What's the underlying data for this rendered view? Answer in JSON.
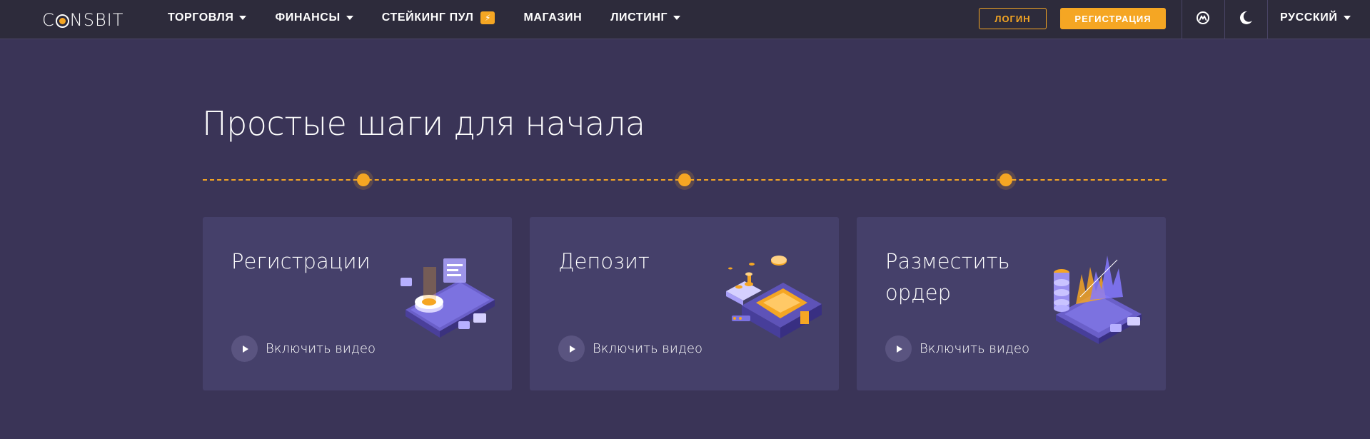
{
  "brand": {
    "logo_pre": "C",
    "logo_post": "NSBIT"
  },
  "nav": {
    "items": [
      {
        "label": "ТОРГОВЛЯ",
        "dropdown": true
      },
      {
        "label": "ФИНАНСЫ",
        "dropdown": true
      },
      {
        "label": "СТЕЙКИНГ ПУЛ",
        "badge_icon": "lightning-icon"
      },
      {
        "label": "МАГАЗИН"
      },
      {
        "label": "ЛИСТИНГ",
        "dropdown": true
      }
    ]
  },
  "header_actions": {
    "login_label": "ЛОГИН",
    "register_label": "РЕГИСТРАЦИЯ",
    "icons": [
      "coinmarketcap-icon",
      "moon-icon"
    ],
    "language": "РУССКИЙ"
  },
  "section": {
    "title": "Простые шаги для начала",
    "steps": [
      {
        "title": "Регистрации",
        "play_label": "Включить видео",
        "illustration": "registration-illustration"
      },
      {
        "title": "Депозит",
        "play_label": "Включить видео",
        "illustration": "deposit-illustration"
      },
      {
        "title": "Разместить ордер",
        "play_label": "Включить видео",
        "illustration": "order-chart-illustration"
      }
    ]
  },
  "colors": {
    "accent": "#f5a623",
    "background": "#3a3457",
    "topbar": "#2d2b3b",
    "card": "#45406a"
  }
}
